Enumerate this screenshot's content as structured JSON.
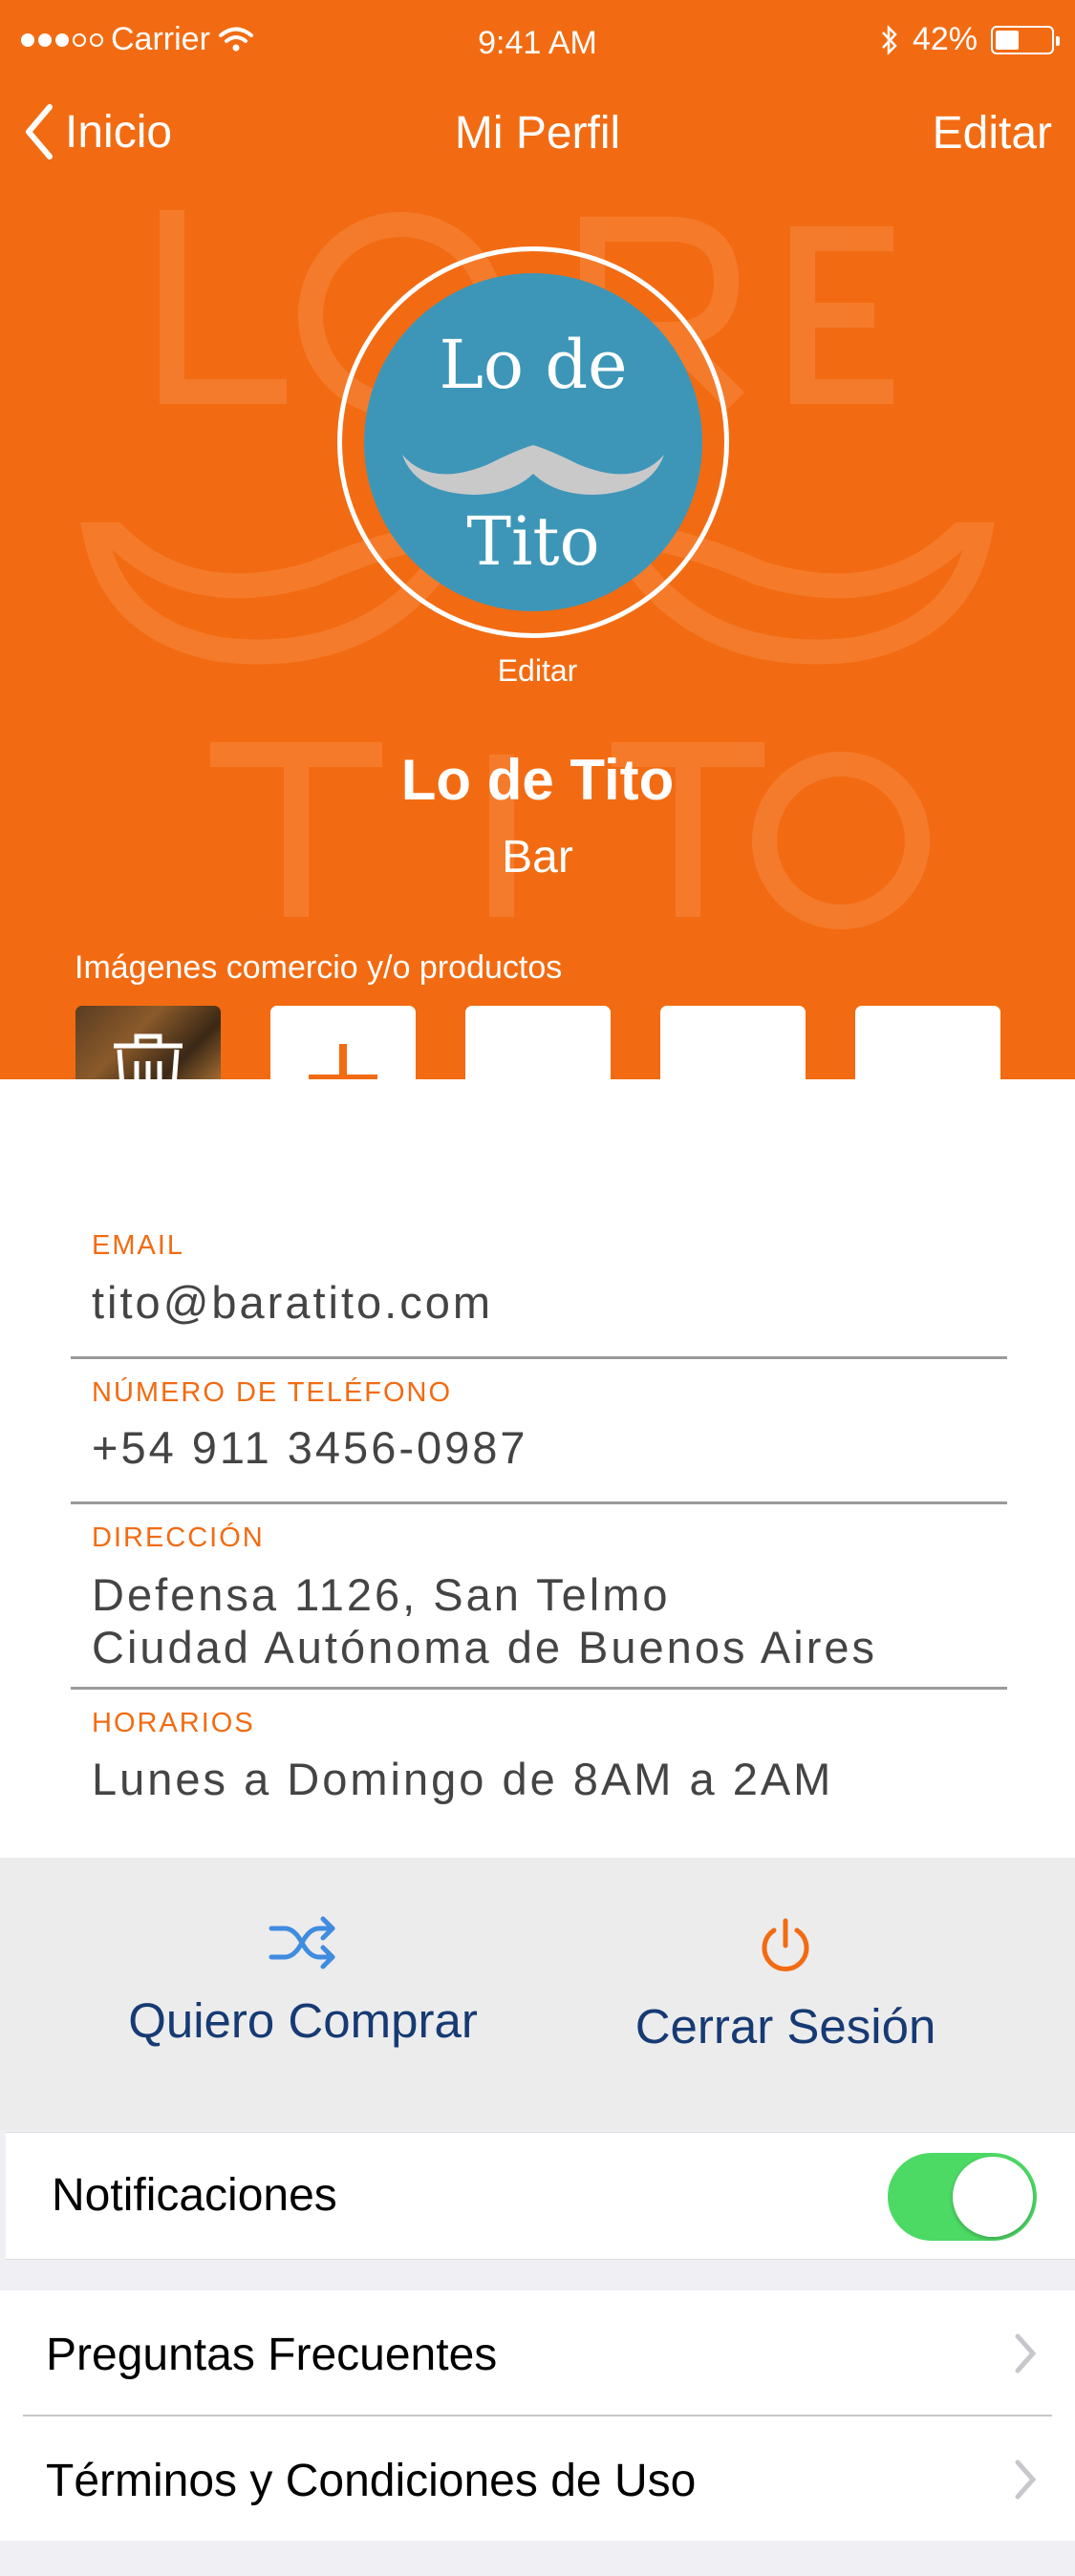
{
  "status_bar": {
    "carrier": "Carrier",
    "time": "9:41 AM",
    "battery_percent_label": "42%",
    "battery_level": 0.42,
    "signal_bars_filled": 3,
    "signal_bars_total": 5
  },
  "nav": {
    "back_label": "Inicio",
    "title": "Mi Perfil",
    "edit_label": "Editar"
  },
  "profile": {
    "logo_text_top": "Lo de",
    "logo_text_bottom": "Tito",
    "avatar_edit_label": "Editar",
    "business_name": "Lo de Tito",
    "business_category": "Bar",
    "images_label": "Imágenes comercio y/o productos"
  },
  "fields": {
    "email_label": "EMAIL",
    "email_value": "tito@baratito.com",
    "phone_label": "NÚMERO DE TELÉFONO",
    "phone_value": "+54 911 3456-0987",
    "address_label": "DIRECCIÓN",
    "address_line1": "Defensa 1126, San Telmo",
    "address_line2": "Ciudad Autónoma de Buenos Aires",
    "hours_label": "HORARIOS",
    "hours_value": "Lunes a Domingo de 8AM a 2AM"
  },
  "actions": {
    "buy_label": "Quiero Comprar",
    "logout_label": "Cerrar Sesión"
  },
  "settings": {
    "notifications_label": "Notificaciones",
    "notifications_on": true,
    "faq_label": "Preguntas Frecuentes",
    "terms_label": "Términos y Condiciones de Uso"
  },
  "colors": {
    "accent": "#f26b12",
    "logo_blue": "#3d96b8",
    "link_blue": "#163a74",
    "toggle_green": "#4cd964",
    "shuffle_icon": "#3f8ce0"
  },
  "icons": [
    "back-chevron-icon",
    "wifi-icon",
    "bluetooth-icon",
    "battery-icon",
    "trash-icon",
    "plus-icon",
    "shuffle-icon",
    "power-icon",
    "chevron-right-icon"
  ]
}
